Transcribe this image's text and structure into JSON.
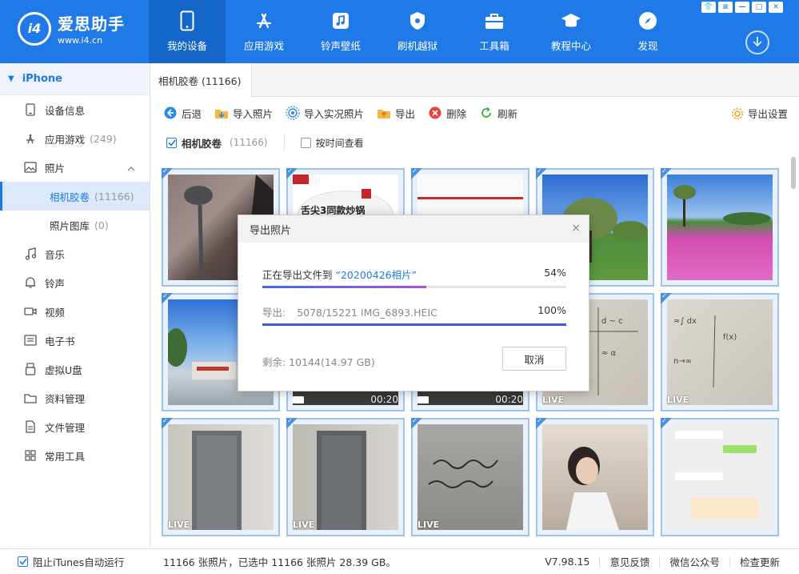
{
  "app": {
    "logo_mark": "i4",
    "title": "爱思助手",
    "url": "www.i4.cn"
  },
  "nav": [
    {
      "label": "我的设备",
      "icon": "phone-icon",
      "active": true
    },
    {
      "label": "应用游戏",
      "icon": "app-store-icon"
    },
    {
      "label": "铃声壁纸",
      "icon": "music-note-icon"
    },
    {
      "label": "刷机越狱",
      "icon": "shield-icon"
    },
    {
      "label": "工具箱",
      "icon": "toolbox-icon"
    },
    {
      "label": "教程中心",
      "icon": "graduation-cap-icon"
    },
    {
      "label": "发现",
      "icon": "compass-icon"
    }
  ],
  "sidebar": {
    "device": "iPhone",
    "items": [
      {
        "label": "设备信息",
        "count": "",
        "icon": "device-info-icon"
      },
      {
        "label": "应用游戏",
        "count": "(249)",
        "icon": "app-icon"
      },
      {
        "label": "照片",
        "count": "",
        "icon": "photo-icon"
      },
      {
        "label": "相机胶卷",
        "count": "(11166)",
        "sub": true,
        "active": true
      },
      {
        "label": "照片图库",
        "count": "(0)",
        "sub": true
      },
      {
        "label": "音乐",
        "count": "",
        "icon": "music-icon"
      },
      {
        "label": "铃声",
        "count": "",
        "icon": "bell-icon"
      },
      {
        "label": "视频",
        "count": "",
        "icon": "video-icon"
      },
      {
        "label": "电子书",
        "count": "",
        "icon": "book-icon"
      },
      {
        "label": "虚拟U盘",
        "count": "",
        "icon": "usb-icon"
      },
      {
        "label": "资料管理",
        "count": "",
        "icon": "folder-icon"
      },
      {
        "label": "文件管理",
        "count": "",
        "icon": "file-icon"
      },
      {
        "label": "常用工具",
        "count": "",
        "icon": "tools-grid-icon"
      }
    ]
  },
  "tab": {
    "label": "相机胶卷 (11166)"
  },
  "toolbar": {
    "back": "后退",
    "import_photo": "导入照片",
    "import_live": "导入实况照片",
    "export": "导出",
    "delete": "删除",
    "refresh": "刷新",
    "export_settings": "导出设置"
  },
  "filter": {
    "album": "相机胶卷",
    "album_count": "(11166)",
    "by_time": "按时间查看"
  },
  "thumbs": [
    {
      "badge": "",
      "dur": ""
    },
    {
      "badge": "",
      "dur": "",
      "caption": "舌尖3同款炒锅"
    },
    {
      "badge": "",
      "dur": ""
    },
    {
      "badge": "",
      "dur": ""
    },
    {
      "badge": "",
      "dur": ""
    },
    {
      "badge": "",
      "dur": ""
    },
    {
      "badge": "",
      "dur": "00:20"
    },
    {
      "badge": "",
      "dur": "00:20"
    },
    {
      "badge": "LIVE",
      "dur": ""
    },
    {
      "badge": "LIVE",
      "dur": ""
    },
    {
      "badge": "LIVE",
      "dur": ""
    },
    {
      "badge": "LIVE",
      "dur": ""
    },
    {
      "badge": "LIVE",
      "dur": ""
    },
    {
      "badge": "",
      "dur": ""
    },
    {
      "badge": "",
      "dur": ""
    }
  ],
  "dialog": {
    "title": "导出照片",
    "close": "×",
    "row1_prefix": "正在导出文件到",
    "row1_target": "“20200426相片”",
    "row1_percent": "54%",
    "row1_progress": 0.54,
    "row2_label": "导出:",
    "row2_file": "5078/15221  IMG_6893.HEIC",
    "row2_percent": "100%",
    "row2_progress": 1.0,
    "remaining": "剩余: 10144(14.97 GB)",
    "cancel": "取消"
  },
  "status": {
    "itunes": "阻止iTunes自动运行",
    "info": "11166 张照片，已选中 11166 张照片 28.39 GB。",
    "version": "V7.98.15",
    "feedback": "意见反馈",
    "wechat": "微信公众号",
    "update": "检查更新"
  },
  "colors": {
    "brand": "#1f7ae8",
    "brand_dark": "#1466c9",
    "selection_border": "#9ec4ee"
  }
}
